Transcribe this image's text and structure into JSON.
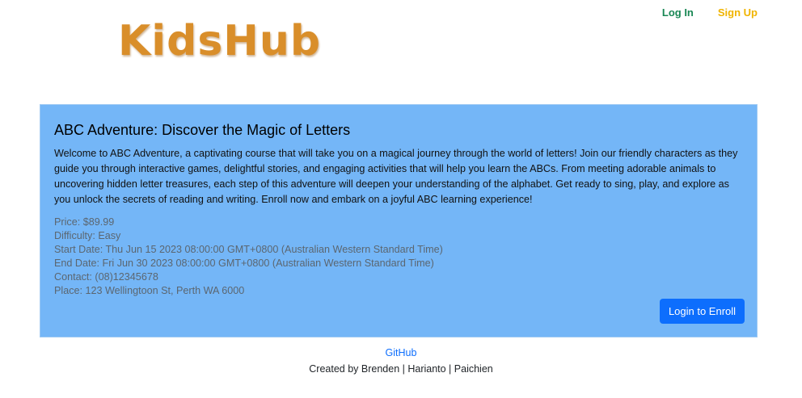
{
  "brand": {
    "logo_text": "KidsHub",
    "logo_color": "#d98e2a"
  },
  "nav": {
    "login_label": "Log In",
    "signup_label": "Sign Up"
  },
  "course": {
    "title": "ABC Adventure: Discover the Magic of Letters",
    "description": "Welcome to ABC Adventure, a captivating course that will take you on a magical journey through the world of letters! Join our friendly characters as they guide you through interactive games, delightful stories, and engaging activities that will help you learn the ABCs. From meeting adorable animals to uncovering hidden letter treasures, each step of this adventure will deepen your understanding of the alphabet. Get ready to sing, play, and explore as you unlock the secrets of reading and writing. Enroll now and embark on a joyful ABC learning experience!",
    "price": "Price: $89.99",
    "difficulty": "Difficulty: Easy",
    "start_date": "Start Date: Thu Jun 15 2023 08:00:00 GMT+0800 (Australian Western Standard Time)",
    "end_date": "End Date: Fri Jun 30 2023 08:00:00 GMT+0800 (Australian Western Standard Time)",
    "contact": "Contact: (08)12345678",
    "place": "Place: 123 Wellingtoon St, Perth WA 6000",
    "enroll_label": "Login to Enroll",
    "card_color": "#74b6f7"
  },
  "footer": {
    "github_label": "GitHub",
    "credits": "Created by Brenden | Harianto | Paichien"
  }
}
